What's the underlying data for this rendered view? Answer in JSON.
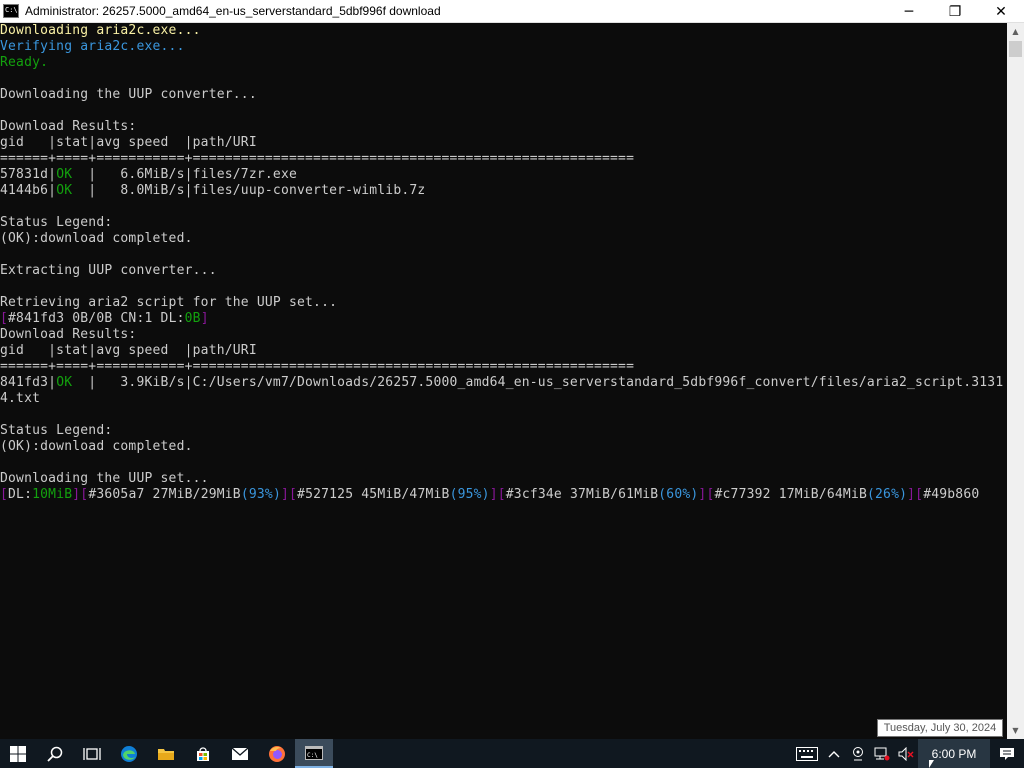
{
  "window": {
    "title": "Administrator:  26257.5000_amd64_en-us_serverstandard_5dbf996f download",
    "minimize": "─",
    "maximize": "❐",
    "close": "✕"
  },
  "console": {
    "lines": [
      [
        {
          "t": "Downloading aria2c.exe...",
          "c": "yellow"
        }
      ],
      [
        {
          "t": "Verifying aria2c.exe...",
          "c": "cyan"
        }
      ],
      [
        {
          "t": "Ready.",
          "c": "green"
        }
      ],
      [
        {
          "t": "",
          "c": "gray"
        }
      ],
      [
        {
          "t": "Downloading the UUP converter...",
          "c": "gray"
        }
      ],
      [
        {
          "t": "",
          "c": "gray"
        }
      ],
      [
        {
          "t": "Download Results:",
          "c": "gray"
        }
      ],
      [
        {
          "t": "gid   |stat|avg speed  |path/URI",
          "c": "gray"
        }
      ],
      [
        {
          "t": "======+====+===========+=======================================================",
          "c": "gray"
        }
      ],
      [
        {
          "t": "57831d|",
          "c": "gray"
        },
        {
          "t": "OK",
          "c": "green"
        },
        {
          "t": "  |   6.6MiB/s|files/7zr.exe",
          "c": "gray"
        }
      ],
      [
        {
          "t": "4144b6|",
          "c": "gray"
        },
        {
          "t": "OK",
          "c": "green"
        },
        {
          "t": "  |   8.0MiB/s|files/uup-converter-wimlib.7z",
          "c": "gray"
        }
      ],
      [
        {
          "t": "",
          "c": "gray"
        }
      ],
      [
        {
          "t": "Status Legend:",
          "c": "gray"
        }
      ],
      [
        {
          "t": "(OK):download completed.",
          "c": "gray"
        }
      ],
      [
        {
          "t": "",
          "c": "gray"
        }
      ],
      [
        {
          "t": "Extracting UUP converter...",
          "c": "gray"
        }
      ],
      [
        {
          "t": "",
          "c": "gray"
        }
      ],
      [
        {
          "t": "Retrieving aria2 script for the UUP set...",
          "c": "gray"
        }
      ],
      [
        {
          "t": "[",
          "c": "purple"
        },
        {
          "t": "#841fd3 0B/0B CN:1 DL:",
          "c": "gray"
        },
        {
          "t": "0B",
          "c": "green"
        },
        {
          "t": "]",
          "c": "purple"
        }
      ],
      [
        {
          "t": "Download Results:",
          "c": "gray"
        }
      ],
      [
        {
          "t": "gid   |stat|avg speed  |path/URI",
          "c": "gray"
        }
      ],
      [
        {
          "t": "======+====+===========+=======================================================",
          "c": "gray"
        }
      ],
      [
        {
          "t": "841fd3|",
          "c": "gray"
        },
        {
          "t": "OK",
          "c": "green"
        },
        {
          "t": "  |   3.9KiB/s|C:/Users/vm7/Downloads/26257.5000_amd64_en-us_serverstandard_5dbf996f_convert/files/aria2_script.3131",
          "c": "gray"
        }
      ],
      [
        {
          "t": "4.txt",
          "c": "gray"
        }
      ],
      [
        {
          "t": "",
          "c": "gray"
        }
      ],
      [
        {
          "t": "Status Legend:",
          "c": "gray"
        }
      ],
      [
        {
          "t": "(OK):download completed.",
          "c": "gray"
        }
      ],
      [
        {
          "t": "",
          "c": "gray"
        }
      ],
      [
        {
          "t": "Downloading the UUP set...",
          "c": "gray"
        }
      ],
      [
        {
          "t": "[",
          "c": "purple"
        },
        {
          "t": "DL:",
          "c": "gray"
        },
        {
          "t": "10MiB",
          "c": "green"
        },
        {
          "t": "][",
          "c": "purple"
        },
        {
          "t": "#3605a7 27MiB/29MiB",
          "c": "gray"
        },
        {
          "t": "(93%)",
          "c": "cyan"
        },
        {
          "t": "][",
          "c": "purple"
        },
        {
          "t": "#527125 45MiB/47MiB",
          "c": "gray"
        },
        {
          "t": "(95%)",
          "c": "cyan"
        },
        {
          "t": "][",
          "c": "purple"
        },
        {
          "t": "#3cf34e 37MiB/61MiB",
          "c": "gray"
        },
        {
          "t": "(60%)",
          "c": "cyan"
        },
        {
          "t": "][",
          "c": "purple"
        },
        {
          "t": "#c77392 17MiB/64MiB",
          "c": "gray"
        },
        {
          "t": "(26%)",
          "c": "cyan"
        },
        {
          "t": "][",
          "c": "purple"
        },
        {
          "t": "#49b860",
          "c": "gray"
        }
      ]
    ]
  },
  "colors": {
    "yellow": "#f9f1a5",
    "cyan": "#3a96dd",
    "green": "#13a10e",
    "gray": "#cccccc",
    "purple": "#881798"
  },
  "tooltip": {
    "text": "Tuesday, July 30, 2024"
  },
  "taskbar": {
    "clock": "6:00 PM",
    "apps": [
      {
        "name": "start-button",
        "icon": "windows-logo-icon"
      },
      {
        "name": "search-button",
        "icon": "search-icon"
      },
      {
        "name": "task-view-button",
        "icon": "task-view-icon"
      },
      {
        "name": "edge-button",
        "icon": "edge-icon"
      },
      {
        "name": "file-explorer-button",
        "icon": "folder-icon"
      },
      {
        "name": "store-button",
        "icon": "store-icon"
      },
      {
        "name": "mail-button",
        "icon": "mail-icon"
      },
      {
        "name": "firefox-button",
        "icon": "firefox-icon"
      },
      {
        "name": "cmd-button",
        "icon": "cmd-icon"
      }
    ]
  }
}
